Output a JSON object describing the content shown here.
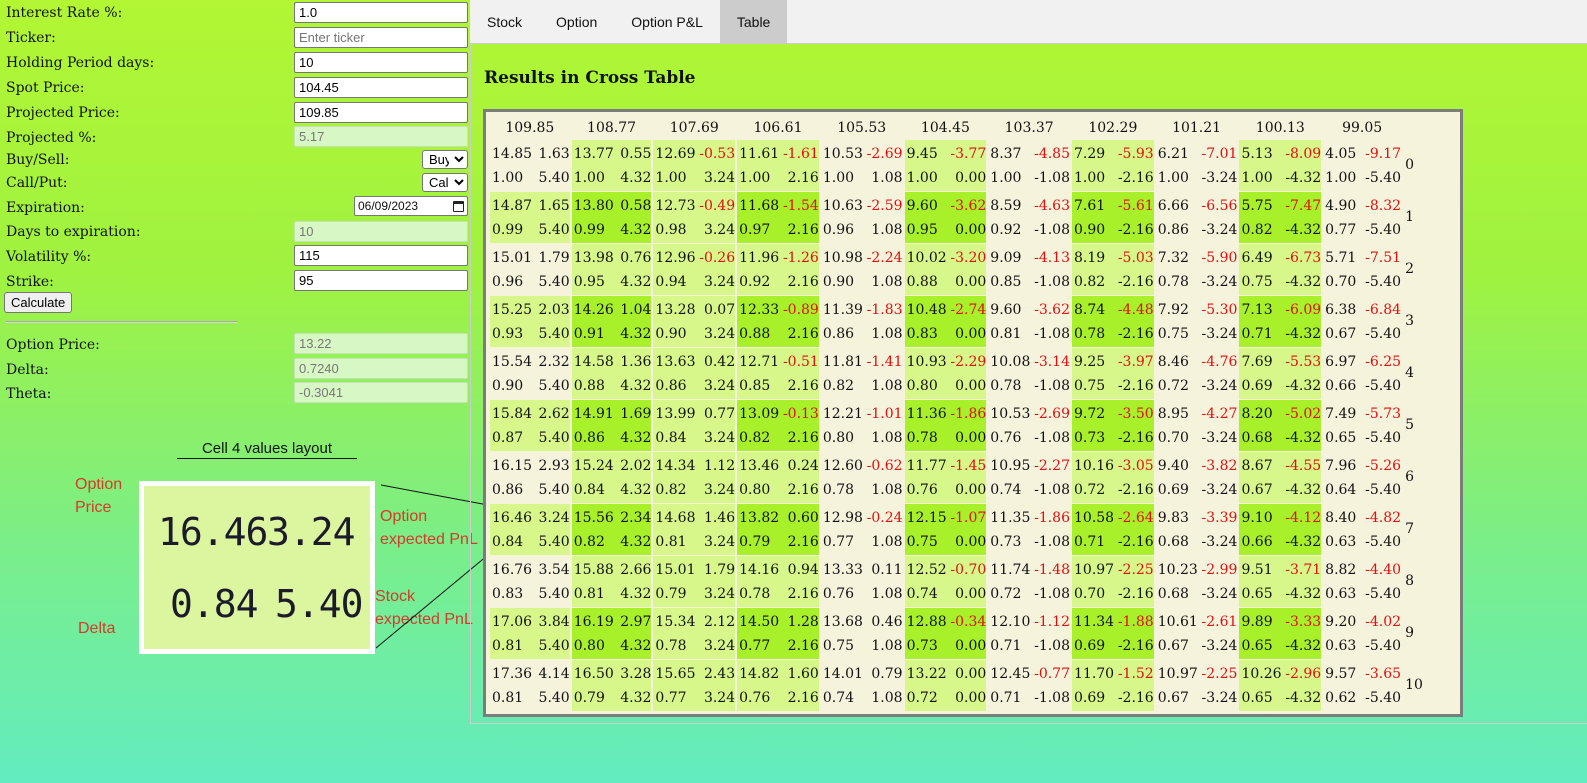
{
  "form": {
    "interest_rate": {
      "label": "Interest Rate %:",
      "value": "1.0"
    },
    "ticker": {
      "label": "Ticker:",
      "placeholder": "Enter ticker"
    },
    "holding_period": {
      "label": "Holding Period days:",
      "value": "10"
    },
    "spot_price": {
      "label": "Spot Price:",
      "value": "104.45"
    },
    "projected_price": {
      "label": "Projected Price:",
      "value": "109.85"
    },
    "projected_pct": {
      "label": "Projected %:",
      "value": "5.17"
    },
    "buy_sell": {
      "label": "Buy/Sell:",
      "value": "Buy"
    },
    "call_put": {
      "label": "Call/Put:",
      "value": "Call"
    },
    "expiration": {
      "label": "Expiration:",
      "value": "06/09/2023"
    },
    "days_to_expiration": {
      "label": "Days to expiration:",
      "value": "10"
    },
    "volatility": {
      "label": "Volatility %:",
      "value": "115"
    },
    "strike": {
      "label": "Strike:",
      "value": "95"
    },
    "calculate_label": "Calculate"
  },
  "results": {
    "option_price": {
      "label": "Option Price:",
      "value": "13.22"
    },
    "delta": {
      "label": "Delta:",
      "value": "0.7240"
    },
    "theta": {
      "label": "Theta:",
      "value": "-0.3041"
    }
  },
  "tabs": [
    {
      "label": "Stock"
    },
    {
      "label": "Option"
    },
    {
      "label": "Option P&L"
    },
    {
      "label": "Table"
    }
  ],
  "section_title": "Results in Cross Table",
  "table": {
    "headers": [
      "109.85",
      "108.77",
      "107.69",
      "106.61",
      "105.53",
      "104.45",
      "103.37",
      "102.29",
      "101.21",
      "100.13",
      "99.05"
    ],
    "rows": [
      {
        "idx": "0",
        "cells": [
          [
            "14.85",
            "1.63",
            "1.00",
            "5.40"
          ],
          [
            "13.77",
            "0.55",
            "1.00",
            "4.32"
          ],
          [
            "12.69",
            "-0.53",
            "1.00",
            "3.24"
          ],
          [
            "11.61",
            "-1.61",
            "1.00",
            "2.16"
          ],
          [
            "10.53",
            "-2.69",
            "1.00",
            "1.08"
          ],
          [
            "9.45",
            "-3.77",
            "1.00",
            "0.00"
          ],
          [
            "8.37",
            "-4.85",
            "1.00",
            "-1.08"
          ],
          [
            "7.29",
            "-5.93",
            "1.00",
            "-2.16"
          ],
          [
            "6.21",
            "-7.01",
            "1.00",
            "-3.24"
          ],
          [
            "5.13",
            "-8.09",
            "1.00",
            "-4.32"
          ],
          [
            "4.05",
            "-9.17",
            "1.00",
            "-5.40"
          ]
        ]
      },
      {
        "idx": "1",
        "cells": [
          [
            "14.87",
            "1.65",
            "0.99",
            "5.40"
          ],
          [
            "13.80",
            "0.58",
            "0.99",
            "4.32"
          ],
          [
            "12.73",
            "-0.49",
            "0.98",
            "3.24"
          ],
          [
            "11.68",
            "-1.54",
            "0.97",
            "2.16"
          ],
          [
            "10.63",
            "-2.59",
            "0.96",
            "1.08"
          ],
          [
            "9.60",
            "-3.62",
            "0.95",
            "0.00"
          ],
          [
            "8.59",
            "-4.63",
            "0.92",
            "-1.08"
          ],
          [
            "7.61",
            "-5.61",
            "0.90",
            "-2.16"
          ],
          [
            "6.66",
            "-6.56",
            "0.86",
            "-3.24"
          ],
          [
            "5.75",
            "-7.47",
            "0.82",
            "-4.32"
          ],
          [
            "4.90",
            "-8.32",
            "0.77",
            "-5.40"
          ]
        ]
      },
      {
        "idx": "2",
        "cells": [
          [
            "15.01",
            "1.79",
            "0.96",
            "5.40"
          ],
          [
            "13.98",
            "0.76",
            "0.95",
            "4.32"
          ],
          [
            "12.96",
            "-0.26",
            "0.94",
            "3.24"
          ],
          [
            "11.96",
            "-1.26",
            "0.92",
            "2.16"
          ],
          [
            "10.98",
            "-2.24",
            "0.90",
            "1.08"
          ],
          [
            "10.02",
            "-3.20",
            "0.88",
            "0.00"
          ],
          [
            "9.09",
            "-4.13",
            "0.85",
            "-1.08"
          ],
          [
            "8.19",
            "-5.03",
            "0.82",
            "-2.16"
          ],
          [
            "7.32",
            "-5.90",
            "0.78",
            "-3.24"
          ],
          [
            "6.49",
            "-6.73",
            "0.75",
            "-4.32"
          ],
          [
            "5.71",
            "-7.51",
            "0.70",
            "-5.40"
          ]
        ]
      },
      {
        "idx": "3",
        "cells": [
          [
            "15.25",
            "2.03",
            "0.93",
            "5.40"
          ],
          [
            "14.26",
            "1.04",
            "0.91",
            "4.32"
          ],
          [
            "13.28",
            "0.07",
            "0.90",
            "3.24"
          ],
          [
            "12.33",
            "-0.89",
            "0.88",
            "2.16"
          ],
          [
            "11.39",
            "-1.83",
            "0.86",
            "1.08"
          ],
          [
            "10.48",
            "-2.74",
            "0.83",
            "0.00"
          ],
          [
            "9.60",
            "-3.62",
            "0.81",
            "-1.08"
          ],
          [
            "8.74",
            "-4.48",
            "0.78",
            "-2.16"
          ],
          [
            "7.92",
            "-5.30",
            "0.75",
            "-3.24"
          ],
          [
            "7.13",
            "-6.09",
            "0.71",
            "-4.32"
          ],
          [
            "6.38",
            "-6.84",
            "0.67",
            "-5.40"
          ]
        ]
      },
      {
        "idx": "4",
        "cells": [
          [
            "15.54",
            "2.32",
            "0.90",
            "5.40"
          ],
          [
            "14.58",
            "1.36",
            "0.88",
            "4.32"
          ],
          [
            "13.63",
            "0.42",
            "0.86",
            "3.24"
          ],
          [
            "12.71",
            "-0.51",
            "0.85",
            "2.16"
          ],
          [
            "11.81",
            "-1.41",
            "0.82",
            "1.08"
          ],
          [
            "10.93",
            "-2.29",
            "0.80",
            "0.00"
          ],
          [
            "10.08",
            "-3.14",
            "0.78",
            "-1.08"
          ],
          [
            "9.25",
            "-3.97",
            "0.75",
            "-2.16"
          ],
          [
            "8.46",
            "-4.76",
            "0.72",
            "-3.24"
          ],
          [
            "7.69",
            "-5.53",
            "0.69",
            "-4.32"
          ],
          [
            "6.97",
            "-6.25",
            "0.66",
            "-5.40"
          ]
        ]
      },
      {
        "idx": "5",
        "cells": [
          [
            "15.84",
            "2.62",
            "0.87",
            "5.40"
          ],
          [
            "14.91",
            "1.69",
            "0.86",
            "4.32"
          ],
          [
            "13.99",
            "0.77",
            "0.84",
            "3.24"
          ],
          [
            "13.09",
            "-0.13",
            "0.82",
            "2.16"
          ],
          [
            "12.21",
            "-1.01",
            "0.80",
            "1.08"
          ],
          [
            "11.36",
            "-1.86",
            "0.78",
            "0.00"
          ],
          [
            "10.53",
            "-2.69",
            "0.76",
            "-1.08"
          ],
          [
            "9.72",
            "-3.50",
            "0.73",
            "-2.16"
          ],
          [
            "8.95",
            "-4.27",
            "0.70",
            "-3.24"
          ],
          [
            "8.20",
            "-5.02",
            "0.68",
            "-4.32"
          ],
          [
            "7.49",
            "-5.73",
            "0.65",
            "-5.40"
          ]
        ]
      },
      {
        "idx": "6",
        "cells": [
          [
            "16.15",
            "2.93",
            "0.86",
            "5.40"
          ],
          [
            "15.24",
            "2.02",
            "0.84",
            "4.32"
          ],
          [
            "14.34",
            "1.12",
            "0.82",
            "3.24"
          ],
          [
            "13.46",
            "0.24",
            "0.80",
            "2.16"
          ],
          [
            "12.60",
            "-0.62",
            "0.78",
            "1.08"
          ],
          [
            "11.77",
            "-1.45",
            "0.76",
            "0.00"
          ],
          [
            "10.95",
            "-2.27",
            "0.74",
            "-1.08"
          ],
          [
            "10.16",
            "-3.05",
            "0.72",
            "-2.16"
          ],
          [
            "9.40",
            "-3.82",
            "0.69",
            "-3.24"
          ],
          [
            "8.67",
            "-4.55",
            "0.67",
            "-4.32"
          ],
          [
            "7.96",
            "-5.26",
            "0.64",
            "-5.40"
          ]
        ]
      },
      {
        "idx": "7",
        "cells": [
          [
            "16.46",
            "3.24",
            "0.84",
            "5.40"
          ],
          [
            "15.56",
            "2.34",
            "0.82",
            "4.32"
          ],
          [
            "14.68",
            "1.46",
            "0.81",
            "3.24"
          ],
          [
            "13.82",
            "0.60",
            "0.79",
            "2.16"
          ],
          [
            "12.98",
            "-0.24",
            "0.77",
            "1.08"
          ],
          [
            "12.15",
            "-1.07",
            "0.75",
            "0.00"
          ],
          [
            "11.35",
            "-1.86",
            "0.73",
            "-1.08"
          ],
          [
            "10.58",
            "-2.64",
            "0.71",
            "-2.16"
          ],
          [
            "9.83",
            "-3.39",
            "0.68",
            "-3.24"
          ],
          [
            "9.10",
            "-4.12",
            "0.66",
            "-4.32"
          ],
          [
            "8.40",
            "-4.82",
            "0.63",
            "-5.40"
          ]
        ]
      },
      {
        "idx": "8",
        "cells": [
          [
            "16.76",
            "3.54",
            "0.83",
            "5.40"
          ],
          [
            "15.88",
            "2.66",
            "0.81",
            "4.32"
          ],
          [
            "15.01",
            "1.79",
            "0.79",
            "3.24"
          ],
          [
            "14.16",
            "0.94",
            "0.78",
            "2.16"
          ],
          [
            "13.33",
            "0.11",
            "0.76",
            "1.08"
          ],
          [
            "12.52",
            "-0.70",
            "0.74",
            "0.00"
          ],
          [
            "11.74",
            "-1.48",
            "0.72",
            "-1.08"
          ],
          [
            "10.97",
            "-2.25",
            "0.70",
            "-2.16"
          ],
          [
            "10.23",
            "-2.99",
            "0.68",
            "-3.24"
          ],
          [
            "9.51",
            "-3.71",
            "0.65",
            "-4.32"
          ],
          [
            "8.82",
            "-4.40",
            "0.63",
            "-5.40"
          ]
        ]
      },
      {
        "idx": "9",
        "cells": [
          [
            "17.06",
            "3.84",
            "0.81",
            "5.40"
          ],
          [
            "16.19",
            "2.97",
            "0.80",
            "4.32"
          ],
          [
            "15.34",
            "2.12",
            "0.78",
            "3.24"
          ],
          [
            "14.50",
            "1.28",
            "0.77",
            "2.16"
          ],
          [
            "13.68",
            "0.46",
            "0.75",
            "1.08"
          ],
          [
            "12.88",
            "-0.34",
            "0.73",
            "0.00"
          ],
          [
            "12.10",
            "-1.12",
            "0.71",
            "-1.08"
          ],
          [
            "11.34",
            "-1.88",
            "0.69",
            "-2.16"
          ],
          [
            "10.61",
            "-2.61",
            "0.67",
            "-3.24"
          ],
          [
            "9.89",
            "-3.33",
            "0.65",
            "-4.32"
          ],
          [
            "9.20",
            "-4.02",
            "0.63",
            "-5.40"
          ]
        ]
      },
      {
        "idx": "10",
        "cells": [
          [
            "17.36",
            "4.14",
            "0.81",
            "5.40"
          ],
          [
            "16.50",
            "3.28",
            "0.79",
            "4.32"
          ],
          [
            "15.65",
            "2.43",
            "0.77",
            "3.24"
          ],
          [
            "14.82",
            "1.60",
            "0.76",
            "2.16"
          ],
          [
            "14.01",
            "0.79",
            "0.74",
            "1.08"
          ],
          [
            "13.22",
            "0.00",
            "0.72",
            "0.00"
          ],
          [
            "12.45",
            "-0.77",
            "0.71",
            "-1.08"
          ],
          [
            "11.70",
            "-1.52",
            "0.69",
            "-2.16"
          ],
          [
            "10.97",
            "-2.25",
            "0.67",
            "-3.24"
          ],
          [
            "10.26",
            "-2.96",
            "0.65",
            "-4.32"
          ],
          [
            "9.57",
            "-3.65",
            "0.62",
            "-5.40"
          ]
        ]
      }
    ]
  },
  "legend": {
    "title": "Cell 4 values layout",
    "option_price_value": "16.46",
    "option_pnl_value": "3.24",
    "delta_value": "0.84",
    "stock_pnl_value": "5.40",
    "label_option_price": "Option Price",
    "label_delta": "Delta",
    "label_option_pnl": "Option expected PnL",
    "label_stock_pnl": "Stock expected PnL"
  },
  "colors": {
    "negative": "#e01010",
    "cell_light": "#d8f78a",
    "cell_bright": "#a7f02a",
    "cell_cream": "#f5f3dc",
    "annotation_red": "#d63a2a"
  }
}
